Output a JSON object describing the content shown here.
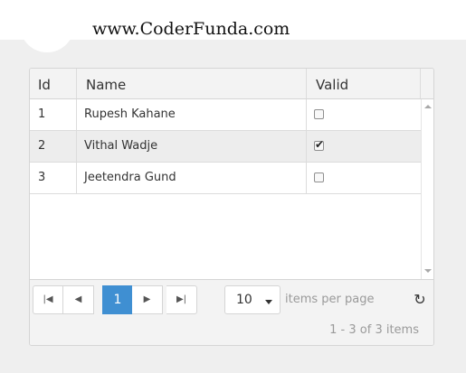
{
  "site": {
    "title": "www.CoderFunda.com"
  },
  "grid": {
    "columns": [
      {
        "label": "Id"
      },
      {
        "label": "Name"
      },
      {
        "label": "Valid"
      }
    ],
    "rows": [
      {
        "id": "1",
        "name": "Rupesh Kahane",
        "valid": false
      },
      {
        "id": "2",
        "name": "Vithal Wadje",
        "valid": true
      },
      {
        "id": "3",
        "name": "Jeetendra Gund",
        "valid": false
      }
    ],
    "checked_mark": "✔"
  },
  "pager": {
    "first_icon": "|◀",
    "prev_icon": "◀",
    "current_page": "1",
    "next_icon": "▶",
    "last_icon": "▶|",
    "page_size": "10",
    "items_per_page_label": "items per page",
    "refresh_icon": "↻",
    "info": "1 - 3 of 3 items"
  },
  "colors": {
    "accent": "#3f8fd2",
    "page_background": "#efefef",
    "header_background": "#f3f3f3",
    "selected_row": "#ededed"
  }
}
